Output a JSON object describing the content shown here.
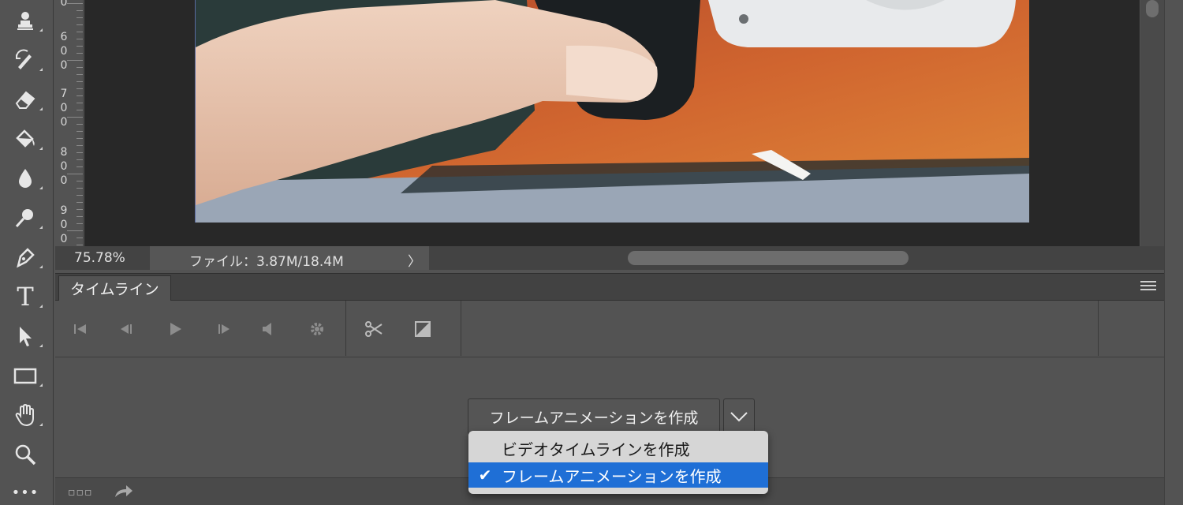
{
  "ruler": {
    "marks": [
      {
        "digits": [
          "0"
        ]
      },
      {
        "digits": [
          "6",
          "0",
          "0"
        ]
      },
      {
        "digits": [
          "7",
          "0",
          "0"
        ]
      },
      {
        "digits": [
          "8",
          "0",
          "0"
        ]
      },
      {
        "digits": [
          "9",
          "0",
          "0"
        ]
      }
    ]
  },
  "status": {
    "zoom": "75.78%",
    "file_info": "ファイル：3.87M/18.4M",
    "arrow": "〉"
  },
  "timeline": {
    "tab_label": "タイムライン",
    "create_button_label": "フレームアニメーションを作成",
    "controls": [
      "skip-to-start-icon",
      "previous-frame-icon",
      "play-icon",
      "next-frame-icon",
      "audio-icon",
      "settings-gear-icon",
      "scissors-icon",
      "transition-icon"
    ]
  },
  "dropdown_menu": {
    "items": [
      {
        "label": "ビデオタイムラインを作成",
        "checked": false
      },
      {
        "label": "フレームアニメーションを作成",
        "checked": true,
        "check_mark": "✔"
      }
    ]
  },
  "toolbar": {
    "tools": [
      "clone-stamp-icon",
      "history-brush-icon",
      "eraser-icon",
      "paint-bucket-icon",
      "blur-drop-icon",
      "dodge-icon",
      "pen-icon",
      "type-icon",
      "path-selection-icon",
      "rectangle-icon",
      "hand-icon",
      "zoom-icon",
      "more-tools-icon"
    ],
    "type_glyph": "T",
    "more_glyph": "•••"
  },
  "colors": {
    "highlight": "#1f6fd6",
    "panel_bg": "#535353",
    "canvas_bg": "#282828"
  }
}
